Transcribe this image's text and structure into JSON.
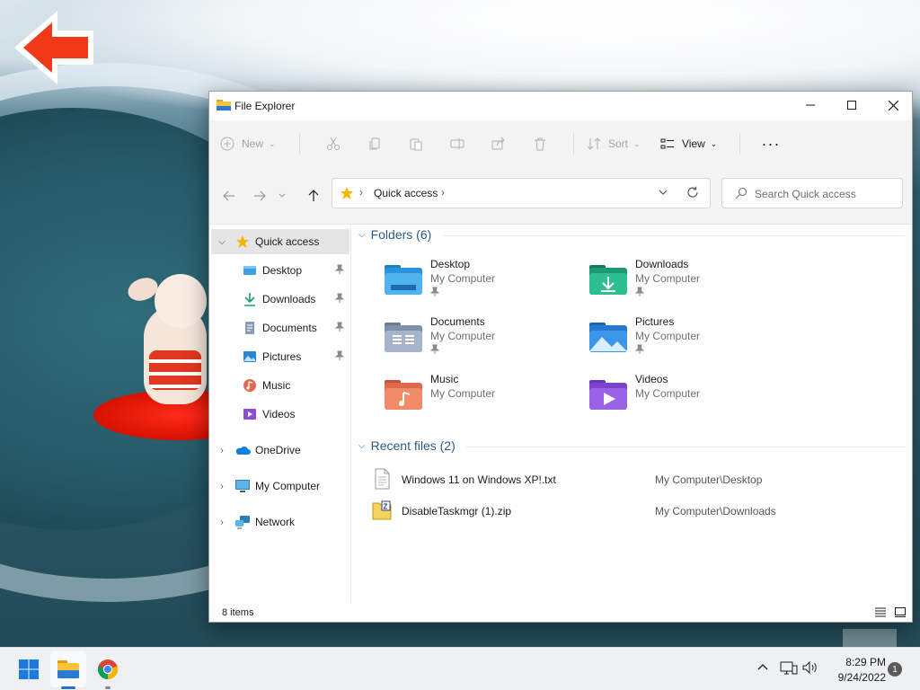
{
  "window": {
    "title": "File Explorer"
  },
  "toolbar": {
    "new_label": "New",
    "sort_label": "Sort",
    "view_label": "View",
    "more_label": "···"
  },
  "address": {
    "path": "Quick access",
    "search_placeholder": "Search Quick access"
  },
  "sidebar": {
    "items": [
      {
        "label": "Quick access",
        "icon": "star-icon"
      },
      {
        "label": "Desktop",
        "icon": "desktop-icon",
        "pinned": true
      },
      {
        "label": "Downloads",
        "icon": "download-icon",
        "pinned": true
      },
      {
        "label": "Documents",
        "icon": "documents-icon",
        "pinned": true
      },
      {
        "label": "Pictures",
        "icon": "pictures-icon",
        "pinned": true
      },
      {
        "label": "Music",
        "icon": "music-icon"
      },
      {
        "label": "Videos",
        "icon": "videos-icon"
      },
      {
        "label": "OneDrive",
        "icon": "onedrive-icon"
      },
      {
        "label": "My Computer",
        "icon": "computer-icon"
      },
      {
        "label": "Network",
        "icon": "network-icon"
      }
    ]
  },
  "folders": {
    "heading": "Folders (6)",
    "items": [
      {
        "name": "Desktop",
        "location": "My Computer",
        "pinned": true
      },
      {
        "name": "Downloads",
        "location": "My Computer",
        "pinned": true
      },
      {
        "name": "Documents",
        "location": "My Computer",
        "pinned": true
      },
      {
        "name": "Pictures",
        "location": "My Computer",
        "pinned": true
      },
      {
        "name": "Music",
        "location": "My Computer"
      },
      {
        "name": "Videos",
        "location": "My Computer"
      }
    ]
  },
  "recent": {
    "heading": "Recent files (2)",
    "items": [
      {
        "name": "Windows 11 on Windows XP!.txt",
        "location": "My Computer\\Desktop"
      },
      {
        "name": "DisableTaskmgr (1).zip",
        "location": "My Computer\\Downloads"
      }
    ]
  },
  "status": {
    "item_count": "8 items"
  },
  "taskbar": {
    "time": "8:29 PM",
    "date": "9/24/2022",
    "notification_count": "1"
  },
  "colors": {
    "accent": "#2c5a86",
    "taskbar": "#eef0f3",
    "selection": "#e5e5e5"
  }
}
